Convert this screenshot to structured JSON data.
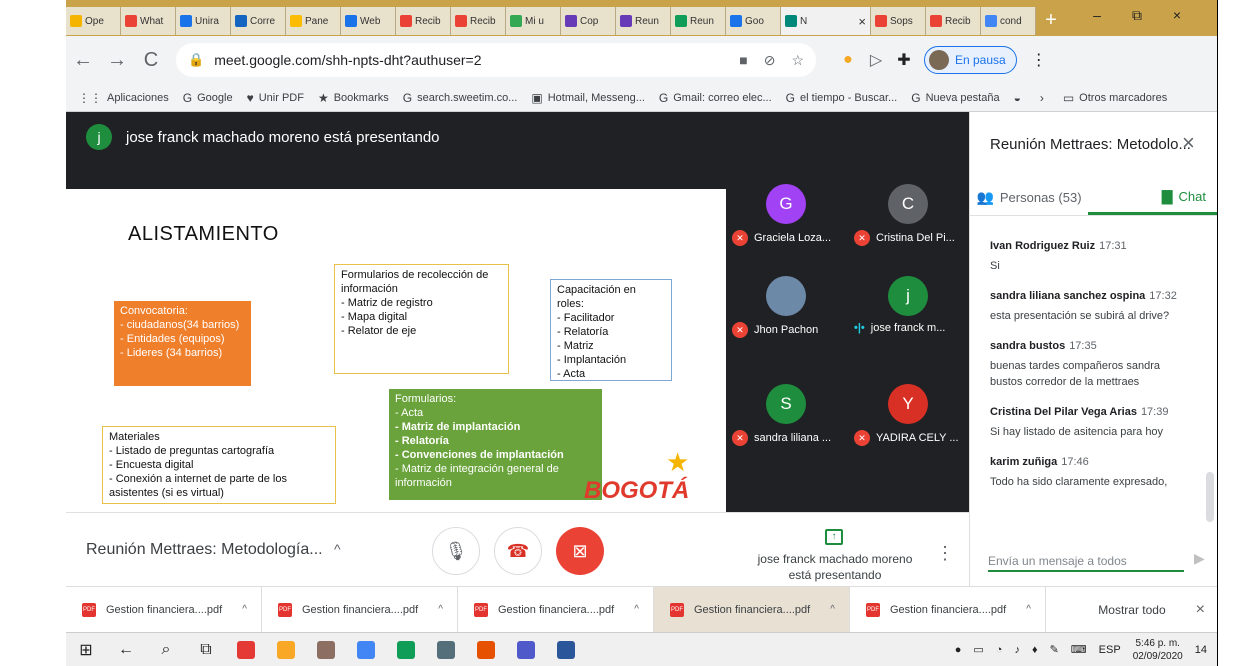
{
  "browser": {
    "tabs": [
      {
        "label": "Ope",
        "color": "#f4b400",
        "close": ""
      },
      {
        "label": "What",
        "color": "#ea4335",
        "close": ""
      },
      {
        "label": "Unira",
        "color": "#1a73e8",
        "close": ""
      },
      {
        "label": "Corre",
        "color": "#1565c0",
        "close": ""
      },
      {
        "label": "Pane",
        "color": "#fbbc04",
        "close": ""
      },
      {
        "label": "Web",
        "color": "#1a73e8",
        "close": ""
      },
      {
        "label": "Recib",
        "color": "#ea4335",
        "close": ""
      },
      {
        "label": "Recib",
        "color": "#ea4335",
        "close": ""
      },
      {
        "label": "Mi u",
        "color": "#34a853",
        "close": ""
      },
      {
        "label": "Cop",
        "color": "#673ab7",
        "close": ""
      },
      {
        "label": "Reun",
        "color": "#673ab7",
        "close": ""
      },
      {
        "label": "Reun",
        "color": "#0f9d58",
        "close": ""
      },
      {
        "label": "Goo",
        "color": "#1a73e8",
        "close": ""
      },
      {
        "label": "N",
        "color": "#00897b",
        "close": "×",
        "active": true
      },
      {
        "label": "Sops",
        "color": "#ea4335",
        "close": ""
      },
      {
        "label": "Recib",
        "color": "#ea4335",
        "close": ""
      },
      {
        "label": "cond",
        "color": "#4285f4",
        "close": ""
      }
    ],
    "new_tab": "+",
    "window_controls": {
      "minimize": "–",
      "restore": "⧉",
      "close": "×"
    },
    "url": "meet.google.com/shh-npts-dht?authuser=2",
    "pause_label": "En pausa",
    "bookmarks": [
      {
        "icon": "⋮⋮",
        "label": "Aplicaciones"
      },
      {
        "icon": "G",
        "label": "Google"
      },
      {
        "icon": "♥",
        "label": "Unir PDF"
      },
      {
        "icon": "★",
        "label": "Bookmarks"
      },
      {
        "icon": "G",
        "label": "search.sweetim.co..."
      },
      {
        "icon": "▣",
        "label": "Hotmail, Messeng..."
      },
      {
        "icon": "G",
        "label": "Gmail: correo elec..."
      },
      {
        "icon": "G",
        "label": "el tiempo - Buscar..."
      },
      {
        "icon": "G",
        "label": "Nueva pestaña"
      },
      {
        "icon": "◒",
        "label": ""
      },
      {
        "icon": "›",
        "label": ""
      },
      {
        "icon": "▭",
        "label": "Otros marcadores"
      }
    ]
  },
  "meet": {
    "presenter_initial": "j",
    "presenter_banner": "jose franck machado moreno está presentando",
    "slide": {
      "title": "ALISTAMIENTO",
      "forms_box": {
        "heading": "Formularios de recolección de información",
        "items": [
          "Matriz de registro",
          "Mapa digital",
          "Relator de eje"
        ]
      },
      "training_box": {
        "heading": "Capacitación en roles:",
        "items": [
          "Facilitador",
          "Relatoría",
          "Matriz",
          "Implantación",
          "Acta"
        ]
      },
      "call_box": {
        "heading": "Convocatoria:",
        "items": [
          "ciudadanos(34 barrios)",
          "Entidades (equipos)",
          "Lideres (34 barrios)"
        ]
      },
      "materials_box": {
        "heading": "Materiales",
        "items": [
          "Listado de preguntas cartografía",
          "Encuesta digital",
          "Conexión a internet de parte de los asistentes (si es virtual)"
        ]
      },
      "forms2_box": {
        "heading": "Formularios:",
        "items": [
          "Acta",
          "Matriz de implantación",
          "Relatoría",
          "Convenciones de implantación",
          "Matriz de integración general de información"
        ]
      },
      "logo_text": "BOGOTÁ"
    },
    "participants": [
      {
        "initial": "G",
        "name": "Graciela Loza...",
        "color": "#a142f4",
        "muted": true
      },
      {
        "initial": "C",
        "name": "Cristina Del Pi...",
        "color": "#5f6368",
        "muted": true
      },
      {
        "initial": "",
        "name": "Jhon Pachon",
        "color": "#6c8aa8",
        "muted": true
      },
      {
        "initial": "j",
        "name": "jose franck m...",
        "color": "#1e8e3e",
        "muted": false
      },
      {
        "initial": "S",
        "name": "sandra liliana ...",
        "color": "#1e8e3e",
        "muted": true
      },
      {
        "initial": "Y",
        "name": "YADIRA CELY ...",
        "color": "#d93025",
        "muted": true
      }
    ],
    "side_panel": {
      "title": "Reunión Mettraes: Metodolo...",
      "people_tab": "Personas (53)",
      "chat_tab": "Chat",
      "messages": [
        {
          "who": "Ivan Rodriguez Ruiz",
          "time": "17:31",
          "text": "Si"
        },
        {
          "who": "sandra liliana sanchez ospina",
          "time": "17:32",
          "text": "esta presentación se subirá al drive?"
        },
        {
          "who": "sandra bustos",
          "time": "17:35",
          "text": "buenas tardes compañeros sandra bustos corredor de la mettraes"
        },
        {
          "who": "Cristina Del Pilar Vega Arias",
          "time": "17:39",
          "text": "Si hay listado de asitencia para hoy"
        },
        {
          "who": "karim zuñiga",
          "time": "17:46",
          "text": "Todo ha sido claramente expresado,"
        }
      ],
      "input_placeholder": "Envía un mensaje a todos"
    },
    "controls": {
      "meeting_title": "Reunión Mettraes: Metodología...",
      "presenting_text": "jose franck machado moreno está presentando"
    }
  },
  "downloads": {
    "items": [
      "Gestion financiera....pdf",
      "Gestion financiera....pdf",
      "Gestion financiera....pdf",
      "Gestion financiera....pdf",
      "Gestion financiera....pdf"
    ],
    "show_all": "Mostrar todo"
  },
  "taskbar": {
    "apps": [
      "#e53935",
      "#f9a825",
      "#8d6e63",
      "#4285f4",
      "#0f9d58",
      "#546e7a",
      "#e65100",
      "#5059c9",
      "#2b579a"
    ],
    "lang": "ESP",
    "time": "5:46 p. m.",
    "date": "02/09/2020",
    "notif_count": "14"
  }
}
